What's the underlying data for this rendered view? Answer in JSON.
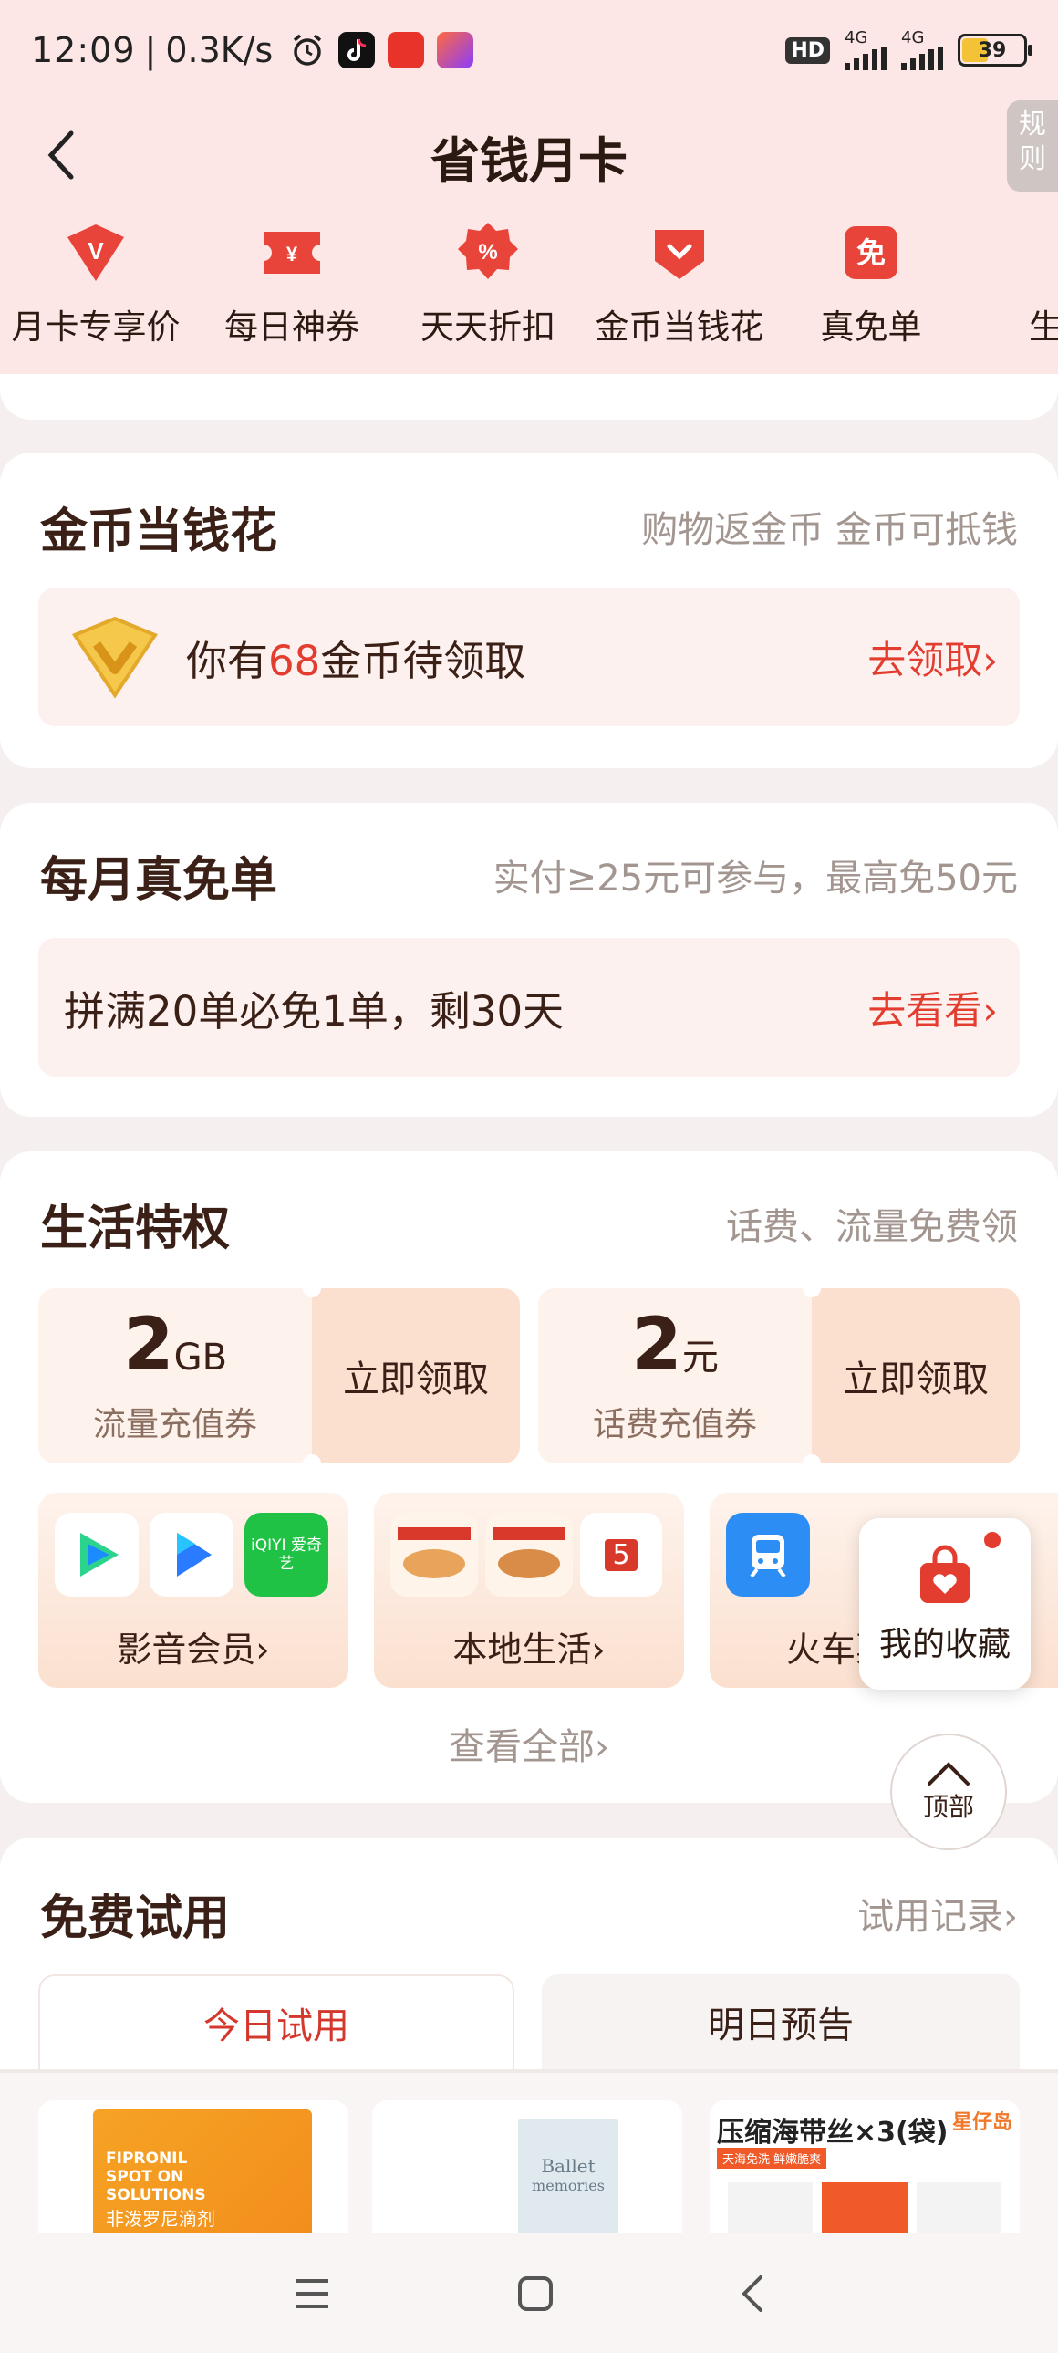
{
  "status_bar": {
    "time": "12:09",
    "net_speed": "0.3K/s",
    "hd_badge": "HD",
    "signal1": "4G",
    "signal2": "4G",
    "battery": "39"
  },
  "header": {
    "title": "省钱月卡",
    "rules_tab": "规则"
  },
  "tabs": [
    {
      "label": "月卡专享价",
      "icon": "v-badge-icon"
    },
    {
      "label": "每日神券",
      "icon": "coupon-icon"
    },
    {
      "label": "天天折扣",
      "icon": "discount-icon"
    },
    {
      "label": "金币当钱花",
      "icon": "heart-coin-icon"
    },
    {
      "label": "真免单",
      "icon": "free-icon"
    },
    {
      "label": "生活",
      "icon": "life-icon"
    }
  ],
  "coins": {
    "title": "金币当钱花",
    "subtitle": "购物返金币 金币可抵钱",
    "prefix": "你有",
    "amount": "68",
    "suffix": "金币待领取",
    "link": "去领取",
    "chevron": "›"
  },
  "free_order": {
    "title": "每月真免单",
    "subtitle": "实付≥25元可参与，最高免50元",
    "text": "拼满20单必免1单，剩30天",
    "link": "去看看",
    "chevron": "›"
  },
  "life": {
    "title": "生活特权",
    "subtitle": "话费、流量免费领",
    "perks": [
      {
        "amount": "2",
        "unit": "GB",
        "name": "流量充值券",
        "button": "立即领取"
      },
      {
        "amount": "2",
        "unit": "元",
        "name": "话费充值券",
        "button": "立即领取"
      }
    ],
    "services": [
      {
        "label": "影音会员",
        "chevron": "›",
        "icon_text": "iQIYI 爱奇艺"
      },
      {
        "label": "本地生活",
        "chevron": "›",
        "icon_text": "5"
      },
      {
        "label": "火车票",
        "chevron": "›"
      }
    ],
    "see_all": "查看全部",
    "see_all_chevron": "›"
  },
  "floating": {
    "favorites": "我的收藏",
    "top": "顶部"
  },
  "trial": {
    "title": "免费试用",
    "record": "试用记录",
    "record_chevron": "›",
    "tab_today": "今日试用",
    "tab_tomorrow": "明日预告",
    "products": [
      {
        "title": "FIPRONIL SPOT ON SOLUTIONS",
        "sub": "非泼罗尼滴剂"
      },
      {
        "title": "Ballet",
        "sub": "memories"
      },
      {
        "title": "压缩海带丝×3(袋)",
        "brand": "星仔岛",
        "tag": "天海免洗 鲜嫩脆爽"
      }
    ]
  },
  "colors": {
    "header_bg": "#fde6e6",
    "accent_red": "#e23d2f",
    "title_brown": "#3a2016"
  }
}
